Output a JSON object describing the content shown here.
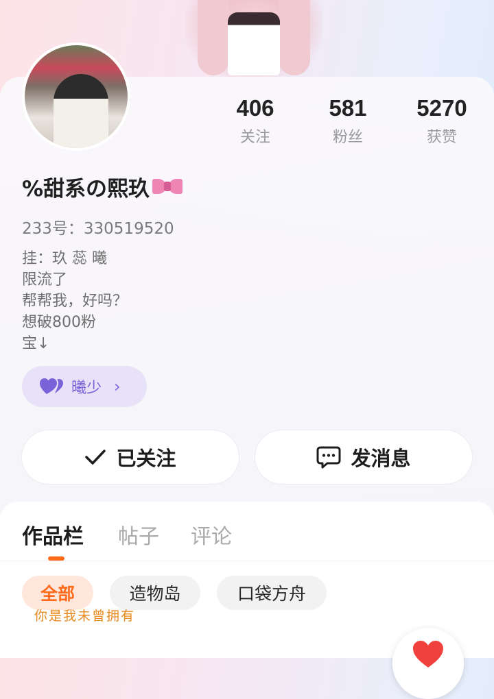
{
  "profile": {
    "name": "%甜系の熙玖",
    "id_text": "233号：330519520",
    "bio_lines": [
      "挂：玖 蕊 曦",
      "限流了",
      "帮帮我，好吗？",
      "想破800粉",
      "宝↓"
    ],
    "friend_tag": "曦少"
  },
  "stats": [
    {
      "value": "406",
      "label": "关注"
    },
    {
      "value": "581",
      "label": "粉丝"
    },
    {
      "value": "5270",
      "label": "获赞"
    }
  ],
  "actions": {
    "follow_label": "已关注",
    "message_label": "发消息"
  },
  "tabs": [
    "作品栏",
    "帖子",
    "评论"
  ],
  "filters": [
    "全部",
    "造物岛",
    "口袋方舟"
  ],
  "overlay_text": "你是我未曾拥有",
  "colors": {
    "accent": "#ff6a1a",
    "friend_tag_text": "#7a63d9",
    "like_heart": "#f0413c"
  },
  "icons": [
    "check-icon",
    "chat-bubble-icon",
    "double-heart-icon",
    "chevron-right-icon",
    "bow-icon",
    "heart-icon"
  ]
}
